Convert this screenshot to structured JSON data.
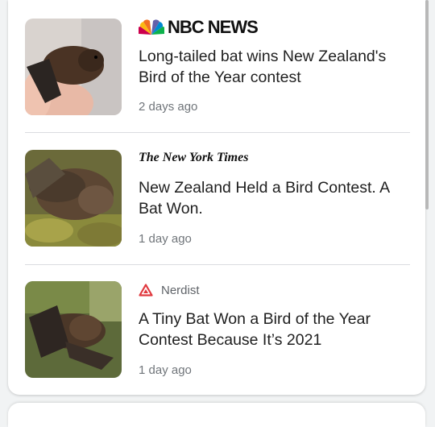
{
  "articles": [
    {
      "source": "NBC NEWS",
      "headline": "Long-tailed bat wins New Zealand's Bird of the Year contest",
      "time": "2 days ago",
      "icon": "nbc-peacock-icon"
    },
    {
      "source": "The New York Times",
      "headline": "New Zealand Held a Bird Contest. A Bat Won.",
      "time": "1 day ago",
      "icon": "nyt-logo"
    },
    {
      "source": "Nerdist",
      "headline": "A Tiny Bat Won a Bird of the Year Contest Because It’s 2021",
      "time": "1 day ago",
      "icon": "nerdist-triangle-icon",
      "icon_color": "#e0383e"
    }
  ],
  "colors": {
    "headline": "#1f1f1f",
    "meta": "#70757a",
    "divider": "#dadce0"
  }
}
